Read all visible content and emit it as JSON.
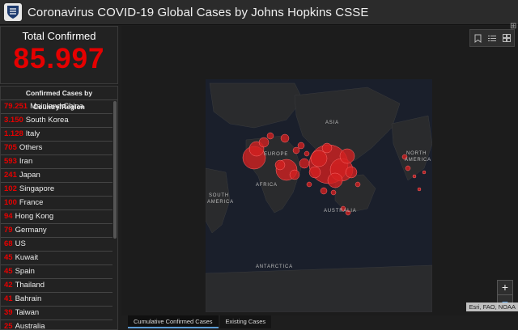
{
  "header": {
    "title": "Coronavirus COVID-19 Global Cases by Johns Hopkins CSSE"
  },
  "total": {
    "label": "Total Confirmed",
    "value": "85.997"
  },
  "list": {
    "header": "Confirmed Cases by Country/Region",
    "items": [
      {
        "count": "79.251",
        "name": "Mainland China"
      },
      {
        "count": "3.150",
        "name": "South Korea"
      },
      {
        "count": "1.128",
        "name": "Italy"
      },
      {
        "count": "705",
        "name": "Others"
      },
      {
        "count": "593",
        "name": "Iran"
      },
      {
        "count": "241",
        "name": "Japan"
      },
      {
        "count": "102",
        "name": "Singapore"
      },
      {
        "count": "100",
        "name": "France"
      },
      {
        "count": "94",
        "name": "Hong Kong"
      },
      {
        "count": "79",
        "name": "Germany"
      },
      {
        "count": "68",
        "name": "US"
      },
      {
        "count": "45",
        "name": "Kuwait"
      },
      {
        "count": "45",
        "name": "Spain"
      },
      {
        "count": "42",
        "name": "Thailand"
      },
      {
        "count": "41",
        "name": "Bahrain"
      },
      {
        "count": "39",
        "name": "Taiwan"
      },
      {
        "count": "25",
        "name": "Australia"
      }
    ]
  },
  "map": {
    "labels": {
      "europe": "EUROPE",
      "africa": "AFRICA",
      "asia": "ASIA",
      "north_america_1": "NORTH",
      "north_america_2": "AMERICA",
      "south_america_1": "SOUTH",
      "south_america_2": "AMERICA",
      "australia": "AUSTRALIA",
      "antarctica": "ANTARCTICA"
    },
    "attribution": "Esri, FAO, NOAA",
    "zoom_in": "+",
    "zoom_out": "−"
  },
  "tabs": [
    {
      "label": "Cumulative Confirmed Cases",
      "active": true
    },
    {
      "label": "Existing Cases",
      "active": false
    }
  ],
  "colors": {
    "accent": "#e60000",
    "bubble": "#d42020",
    "ocean": "#1a1f2b",
    "land": "#2a2a2a"
  }
}
